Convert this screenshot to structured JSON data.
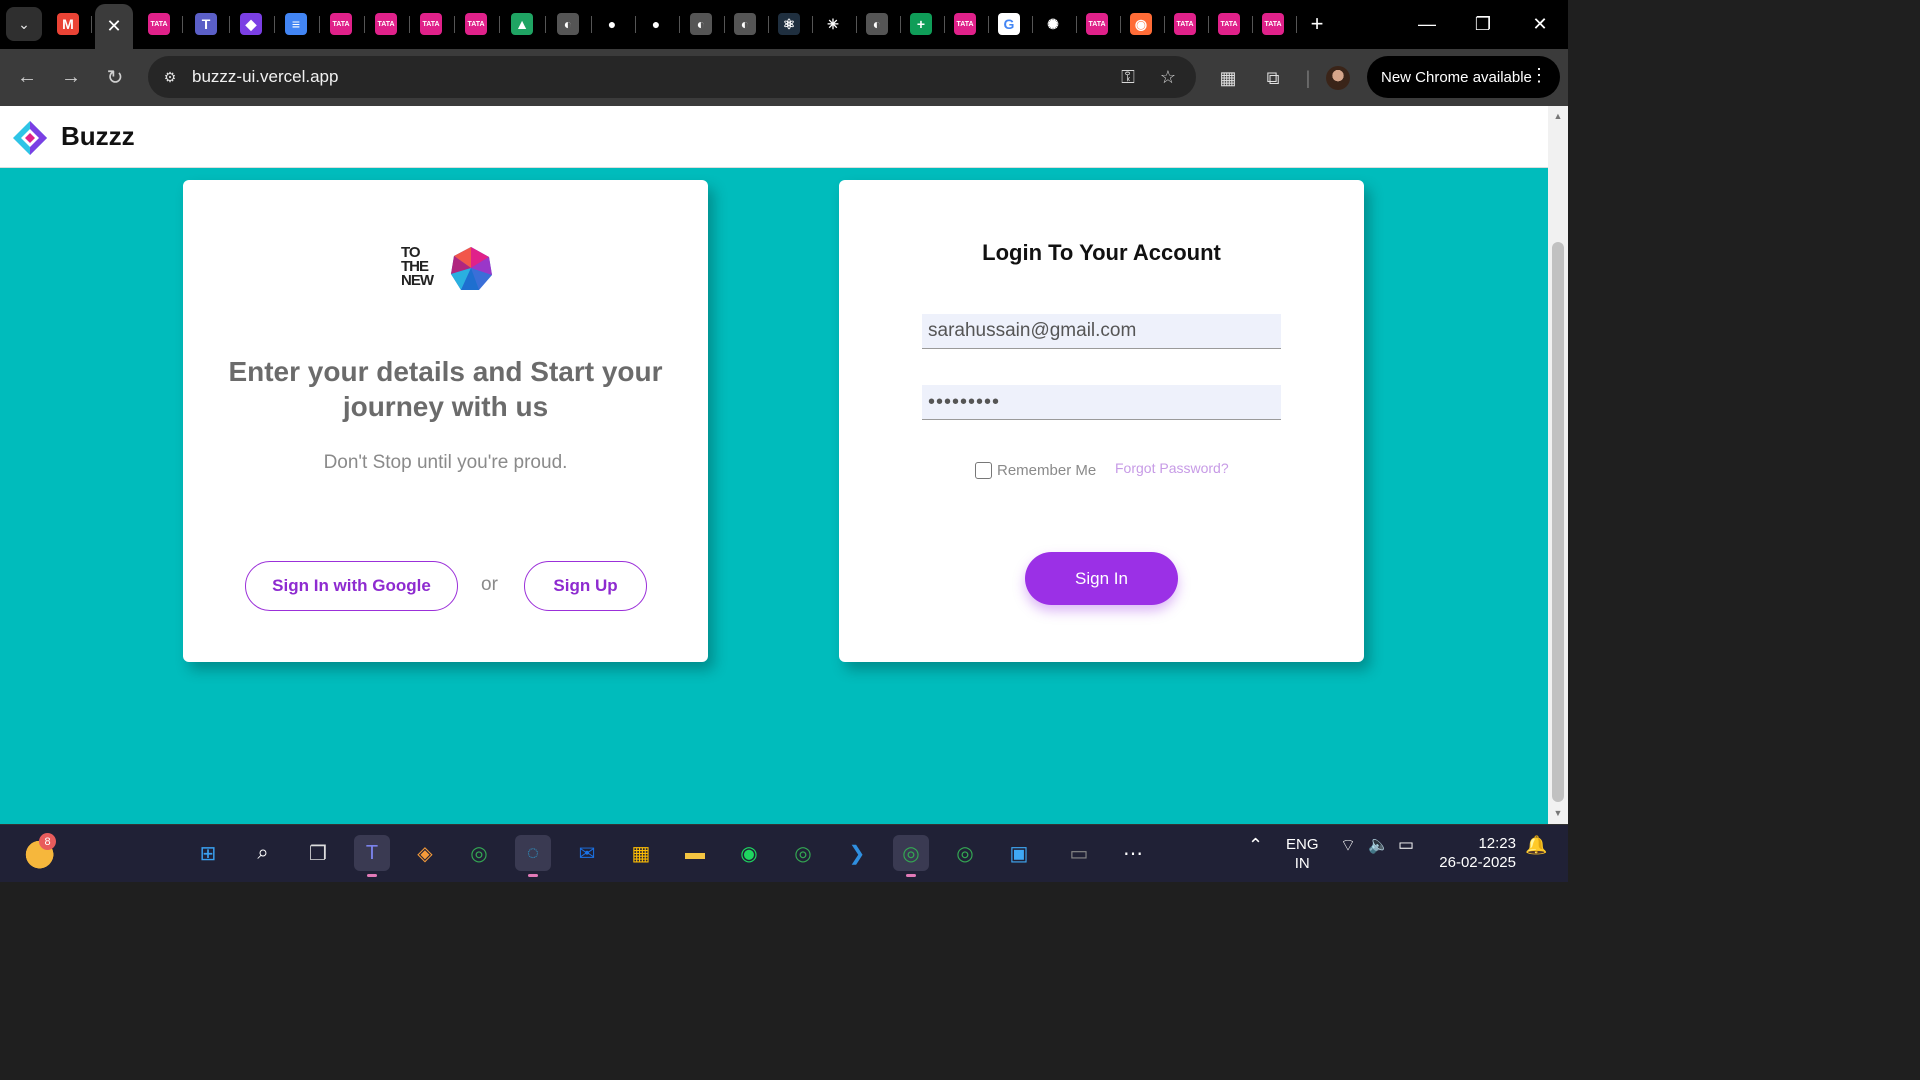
{
  "browser": {
    "active_tab_close": "✕",
    "new_tab": "+",
    "url": "buzzz-ui.vercel.app",
    "update_label": "New Chrome available",
    "tabs": [
      {
        "icon": "gmail-icon",
        "glyph": "M",
        "color": "#ea4335"
      },
      {
        "icon": "tataplay-icon",
        "glyph": "TATA",
        "color": "#e0218a"
      },
      {
        "icon": "teams-icon",
        "glyph": "T",
        "color": "#5b5fc7"
      },
      {
        "icon": "gem-icon",
        "glyph": "◆",
        "color": "#7b3fe4"
      },
      {
        "icon": "docs-icon",
        "glyph": "≡",
        "color": "#4285f4"
      },
      {
        "icon": "tataplay-icon",
        "glyph": "TATA",
        "color": "#e0218a"
      },
      {
        "icon": "tataplay-icon",
        "glyph": "TATA",
        "color": "#e0218a"
      },
      {
        "icon": "tataplay-icon",
        "glyph": "TATA",
        "color": "#e0218a"
      },
      {
        "icon": "tataplay-icon",
        "glyph": "TATA",
        "color": "#e0218a"
      },
      {
        "icon": "drive-icon",
        "glyph": "▲",
        "color": "#1fa463"
      },
      {
        "icon": "globe-icon",
        "glyph": "◐",
        "color": "#555"
      },
      {
        "icon": "github-icon",
        "glyph": "●",
        "color": "#000"
      },
      {
        "icon": "github-icon",
        "glyph": "●",
        "color": "#000"
      },
      {
        "icon": "globe-icon",
        "glyph": "◐",
        "color": "#555"
      },
      {
        "icon": "globe-icon",
        "glyph": "◐",
        "color": "#555"
      },
      {
        "icon": "react-icon",
        "glyph": "⚛",
        "color": "#1f2f3f"
      },
      {
        "icon": "claude-icon",
        "glyph": "✳",
        "color": "#000"
      },
      {
        "icon": "globe-icon",
        "glyph": "◐",
        "color": "#555"
      },
      {
        "icon": "sheets-icon",
        "glyph": "+",
        "color": "#0f9d58"
      },
      {
        "icon": "tataplay-icon",
        "glyph": "TATA",
        "color": "#e0218a"
      },
      {
        "icon": "google-icon",
        "glyph": "G",
        "color": "#fff"
      },
      {
        "icon": "openai-icon",
        "glyph": "✺",
        "color": "#000"
      },
      {
        "icon": "tataplay-icon",
        "glyph": "TATA",
        "color": "#e0218a"
      },
      {
        "icon": "postman-icon",
        "glyph": "◉",
        "color": "#ff6c37"
      },
      {
        "icon": "tataplay-icon",
        "glyph": "TATA",
        "color": "#e0218a"
      },
      {
        "icon": "tataplay-icon",
        "glyph": "TATA",
        "color": "#e0218a"
      },
      {
        "icon": "tataplay-icon",
        "glyph": "TATA",
        "color": "#e0218a"
      }
    ]
  },
  "app": {
    "brand": "Buzzz",
    "left_card": {
      "logo_text": "TO\nTHE\nNEW",
      "headline": "Enter your details and Start your journey with us",
      "subline": "Don't Stop until you're proud.",
      "google_button": "Sign In with Google",
      "or": "or",
      "signup_button": "Sign Up"
    },
    "right_card": {
      "title": "Login To Your Account",
      "email_value": "sarahussain@gmail.com",
      "password_value": "•••••••••",
      "remember_label": "Remember Me",
      "forgot_label": "Forgot Password?",
      "signin_button": "Sign In"
    },
    "colors": {
      "background": "#00bcbc",
      "accent": "#9b30e6"
    }
  },
  "taskbar": {
    "weather_badge": "8",
    "language": "ENG",
    "region": "IN",
    "time": "12:23",
    "date": "26-02-2025",
    "apps": [
      {
        "name": "start-icon",
        "glyph": "⊞",
        "color": "#3aa0f0"
      },
      {
        "name": "search-icon",
        "glyph": "⌕",
        "color": "#fff"
      },
      {
        "name": "task-view-icon",
        "glyph": "❐",
        "color": "#ddd"
      },
      {
        "name": "teams-icon",
        "glyph": "T",
        "color": "#7b83eb",
        "active": true
      },
      {
        "name": "copilot-icon",
        "glyph": "◈",
        "color": "#f59b3a"
      },
      {
        "name": "chrome-icon",
        "glyph": "◎",
        "color": "#34a853"
      },
      {
        "name": "edge-icon",
        "glyph": "◌",
        "color": "#2ba3d8",
        "active": true
      },
      {
        "name": "outlook-icon",
        "glyph": "✉",
        "color": "#1a73e8"
      },
      {
        "name": "store-icon",
        "glyph": "▦",
        "color": "#fbbc04"
      },
      {
        "name": "file-explorer-icon",
        "glyph": "▬",
        "color": "#f4c542"
      },
      {
        "name": "spotify-icon",
        "glyph": "◉",
        "color": "#1ed760"
      },
      {
        "name": "chrome-profile-icon",
        "glyph": "◎",
        "color": "#34a853"
      },
      {
        "name": "vscode-icon",
        "glyph": "❯",
        "color": "#2f8fe0"
      },
      {
        "name": "chrome-active-icon",
        "glyph": "◎",
        "color": "#34a853",
        "active": true
      },
      {
        "name": "chrome-icon",
        "glyph": "◎",
        "color": "#34a853"
      },
      {
        "name": "photos-icon",
        "glyph": "▣",
        "color": "#3fa9f5"
      },
      {
        "name": "terminal-icon",
        "glyph": "▭",
        "color": "#888"
      },
      {
        "name": "more-icon",
        "glyph": "⋯",
        "color": "#fff"
      }
    ]
  }
}
